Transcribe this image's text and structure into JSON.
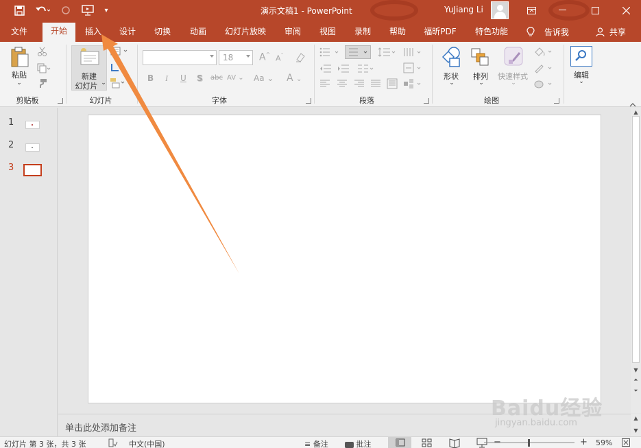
{
  "window": {
    "title": "演示文稿1  -  PowerPoint",
    "user_name": "YuJiang Li"
  },
  "tabs": [
    {
      "label": "文件",
      "active": false
    },
    {
      "label": "开始",
      "active": true
    },
    {
      "label": "插入",
      "active": false
    },
    {
      "label": "设计",
      "active": false
    },
    {
      "label": "切换",
      "active": false
    },
    {
      "label": "动画",
      "active": false
    },
    {
      "label": "幻灯片放映",
      "active": false
    },
    {
      "label": "审阅",
      "active": false
    },
    {
      "label": "视图",
      "active": false
    },
    {
      "label": "录制",
      "active": false
    },
    {
      "label": "帮助",
      "active": false
    },
    {
      "label": "福昕PDF",
      "active": false
    },
    {
      "label": "特色功能",
      "active": false
    }
  ],
  "tell_me": "告诉我",
  "share": "共享",
  "ribbon": {
    "groups": {
      "clipboard": "剪贴板",
      "slides": "幻灯片",
      "font": "字体",
      "paragraph": "段落",
      "drawing": "绘图"
    },
    "paste": "粘贴",
    "new_slide": [
      "新建",
      "幻灯片"
    ],
    "font_size": "18",
    "font_buttons": [
      "B",
      "I",
      "U",
      "S",
      "abc",
      "AV",
      "Aa",
      "A"
    ],
    "grow_font": "A",
    "shrink_font": "A",
    "shapes": "形状",
    "arrange": "排列",
    "quick_styles": "快速样式",
    "editing": "编辑"
  },
  "slides": [
    {
      "number": "1",
      "current": false
    },
    {
      "number": "2",
      "current": false
    },
    {
      "number": "3",
      "current": true
    }
  ],
  "notes_placeholder": "单击此处添加备注",
  "status": {
    "slide_info": "幻灯片 第 3 张，共 3 张",
    "language": "中文(中国)",
    "notes": "备注",
    "comments": "批注",
    "zoom_minus": "−",
    "zoom_plus": "+",
    "zoom": "59%"
  },
  "watermark": {
    "brand": "Baidu经验",
    "url": "jingyan.baidu.com"
  },
  "colors": {
    "accent": "#b7472a",
    "annotation_arrow": "#f08a40"
  }
}
